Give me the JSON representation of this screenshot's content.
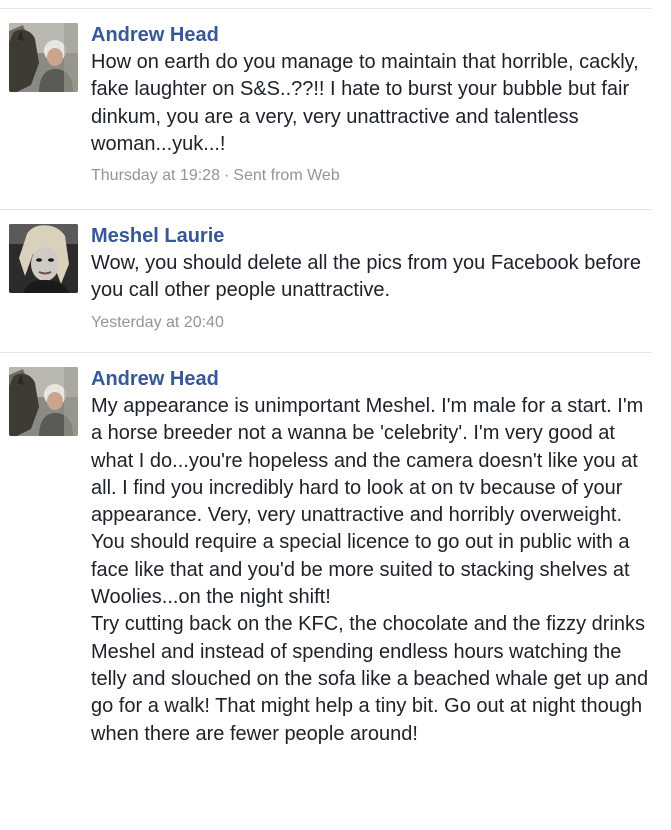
{
  "messages": [
    {
      "sender": "Andrew Head",
      "avatar_icon": "profile-photo-man-with-horse",
      "text": "How on earth do you manage to maintain that horrible, cackly, fake laughter on S&S..??!! I hate to burst your bubble but fair dinkum, you are a very, very unattractive and talentless woman...yuk...!",
      "timestamp": "Thursday at 19:28",
      "separator": "·",
      "source": "Sent from Web"
    },
    {
      "sender": "Meshel Laurie",
      "avatar_icon": "profile-photo-woman",
      "text": "Wow, you should delete all the pics from you Facebook before you call other people unattractive.",
      "timestamp": "Yesterday at 20:40"
    },
    {
      "sender": "Andrew Head",
      "avatar_icon": "profile-photo-man-with-horse",
      "text_lines": [
        "My appearance is unimportant Meshel. I'm male for a start. I'm a horse breeder not a wanna be 'celebrity'. I'm very good at what I do...you're hopeless and the camera doesn't like you at all. I find you incredibly hard to look at on tv because of your appearance. Very, very unattractive and horribly overweight. You should require a special licence to go out in public with a face like that and you'd be more suited to stacking shelves at Woolies...on the night shift!",
        "Try cutting back on the KFC, the chocolate and the fizzy drinks Meshel and instead of spending endless hours watching the telly and slouched on the sofa like a beached whale get up and go for a walk! That might help a tiny bit. Go out at night though when there are fewer people around!"
      ]
    }
  ],
  "colors": {
    "sender_link": "#365899",
    "body_text": "#1d2129",
    "meta_text": "#90949c",
    "divider": "#e2e4e8"
  }
}
